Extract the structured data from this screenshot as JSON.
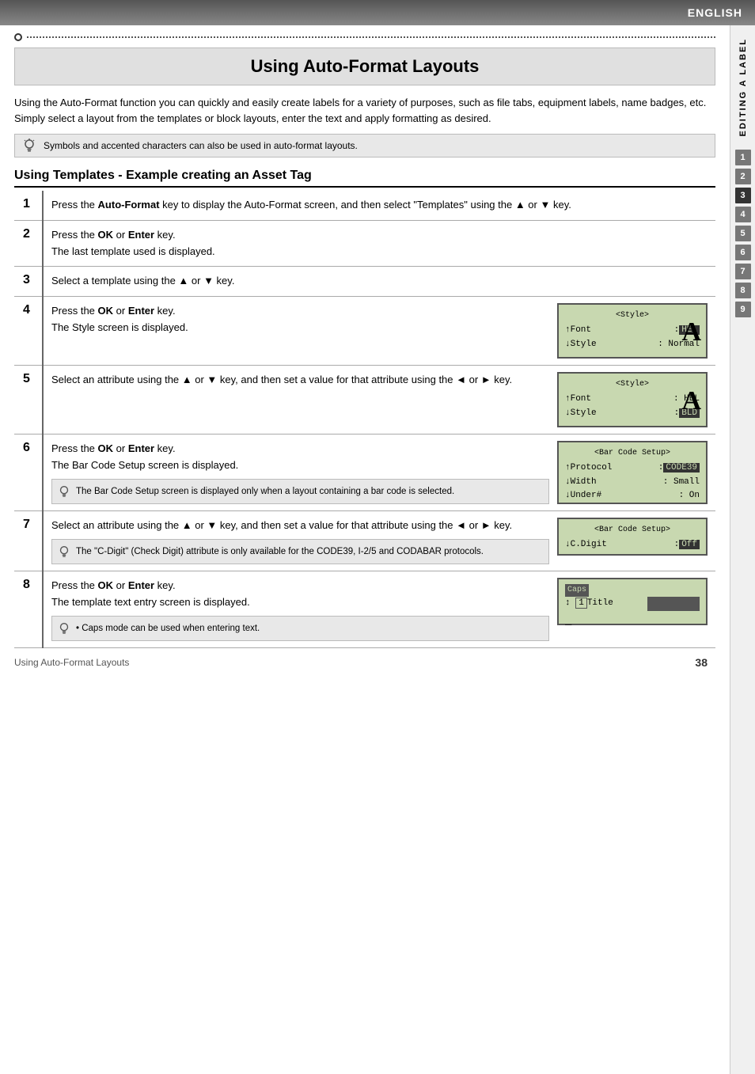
{
  "header": {
    "language": "ENGLISH"
  },
  "sidebar": {
    "label": "EDITING A LABEL",
    "numbers": [
      "1",
      "2",
      "3",
      "4",
      "5",
      "6",
      "7",
      "8",
      "9"
    ],
    "active": "3"
  },
  "page": {
    "dots_decoration": "••••••••••••••••••••••••••••••••••••••••••••••••••••••••••••••••••••••••••••••••••",
    "title": "Using Auto-Format Layouts",
    "intro": "Using the Auto-Format function you can quickly and easily create labels for a variety of purposes, such as file tabs, equipment labels, name badges, etc. Simply select a layout from the templates or block layouts, enter the text and apply formatting as desired.",
    "note_symbols": "Symbols and accented characters can also be used in auto-format layouts.",
    "section_title": "Using Templates - Example creating an Asset Tag",
    "steps": [
      {
        "num": "1",
        "text": "Press the Auto-Format key to display the Auto-Format screen, and then select \"Templates\" using the ▲ or ▼ key.",
        "has_image": false,
        "note": null
      },
      {
        "num": "2",
        "text": "Press the OK or Enter key.\nThe last template used is displayed.",
        "has_image": false,
        "note": null
      },
      {
        "num": "3",
        "text": "Select a template using the ▲ or ▼ key.",
        "has_image": false,
        "note": null
      },
      {
        "num": "4",
        "text": "Press the OK or Enter key.\nThe Style screen is displayed.",
        "has_image": true,
        "image_type": "style1",
        "note": null
      },
      {
        "num": "5",
        "text": "Select an attribute using the ▲ or ▼ key, and then set a value for that attribute using the ◄ or ► key.",
        "has_image": true,
        "image_type": "style2",
        "note": null
      },
      {
        "num": "6",
        "text": "Press the OK or Enter key.\nThe Bar Code Setup screen is displayed.",
        "has_image": true,
        "image_type": "barcode1",
        "note": "The Bar Code Setup screen is displayed only when a layout containing a bar code is selected."
      },
      {
        "num": "7",
        "text": "Select an attribute using the ▲ or ▼ key, and then set a value for that attribute using the ◄ or ► key.",
        "has_image": true,
        "image_type": "barcode2",
        "note": "The \"C-Digit\" (Check Digit) attribute is only available for the CODE39, I-2/5 and CODABAR protocols."
      },
      {
        "num": "8",
        "text": "Press the OK or Enter key.\nThe template text entry screen is displayed.",
        "has_image": true,
        "image_type": "textentry",
        "note": "• Caps mode can be used when entering text."
      }
    ],
    "footer_text": "Using Auto-Format Layouts",
    "page_number": "38"
  }
}
